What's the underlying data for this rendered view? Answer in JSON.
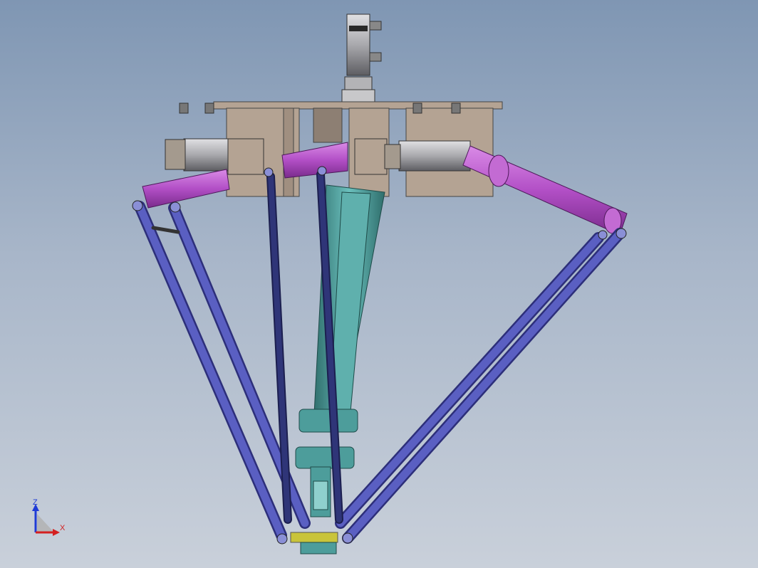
{
  "viewport": {
    "background_top": "#7f96b3",
    "background_bottom": "#c9d0da"
  },
  "model": {
    "colors": {
      "plate": "#b4a393",
      "motor_body": "#b9b9bd",
      "upper_arm": "#b24fc6",
      "lower_link": "#5a5fc2",
      "center_link": "#2f3578",
      "telescopic_shaft": "#4d9d9b",
      "end_effector": "#c9c43a"
    }
  },
  "triad": {
    "z_label": "Z",
    "x_label": "X",
    "z_color": "#1f3bd6",
    "x_color": "#d42020"
  }
}
